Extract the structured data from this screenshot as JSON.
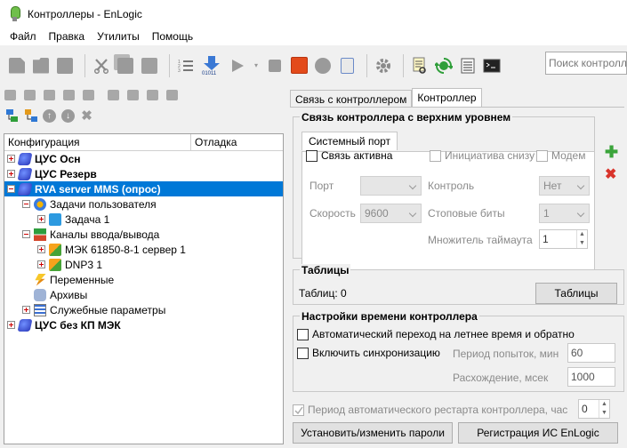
{
  "window": {
    "title": "Контроллеры - EnLogic"
  },
  "menu": [
    "Файл",
    "Правка",
    "Утилиты",
    "Помощь"
  ],
  "search": {
    "placeholder": "Поиск контроллера"
  },
  "tree": {
    "col_config": "Конфигурация",
    "col_debug": "Отладка",
    "nodes": [
      {
        "label": "ЦУС Осн",
        "level": 0,
        "icon": "database-icon",
        "expander": "plus",
        "bold": true,
        "selected": false
      },
      {
        "label": "ЦУС Резерв",
        "level": 0,
        "icon": "database-icon",
        "expander": "plus",
        "bold": true,
        "selected": false
      },
      {
        "label": "RVA server MMS (опрос)",
        "level": 0,
        "icon": "database-icon",
        "expander": "minus",
        "bold": true,
        "selected": true
      },
      {
        "label": "Задачи пользователя",
        "level": 1,
        "icon": "tasks-icon",
        "expander": "minus",
        "bold": false,
        "selected": false
      },
      {
        "label": "Задача 1",
        "level": 2,
        "icon": "cube-icon",
        "expander": "plus",
        "bold": false,
        "selected": false
      },
      {
        "label": "Каналы ввода/вывода",
        "level": 1,
        "icon": "channels-icon",
        "expander": "minus",
        "bold": false,
        "selected": false
      },
      {
        "label": "МЭК 61850-8-1 сервер 1",
        "level": 2,
        "icon": "plug-icon",
        "expander": "plus",
        "bold": false,
        "selected": false
      },
      {
        "label": "DNP3 1",
        "level": 2,
        "icon": "plug-icon",
        "expander": "plus",
        "bold": false,
        "selected": false
      },
      {
        "label": "Переменные",
        "level": 1,
        "icon": "variables-icon",
        "expander": "none",
        "bold": false,
        "selected": false
      },
      {
        "label": "Архивы",
        "level": 1,
        "icon": "archive-icon",
        "expander": "none",
        "bold": false,
        "selected": false
      },
      {
        "label": "Служебные параметры",
        "level": 1,
        "icon": "service-params-icon",
        "expander": "plus",
        "bold": false,
        "selected": false
      },
      {
        "label": "ЦУС без КП МЭК",
        "level": 0,
        "icon": "database-icon",
        "expander": "plus",
        "bold": true,
        "selected": false
      }
    ]
  },
  "tabs": [
    "Связь с контроллером",
    "Контроллер"
  ],
  "active_tab": 1,
  "upper_link": {
    "title": "Связь контроллера с верхним уровнем",
    "subtab": "Системный порт",
    "link_active": "Связь активна",
    "initiative": "Инициатива снизу",
    "modem": "Модем",
    "port_label": "Порт",
    "port_value": "",
    "control_label": "Контроль",
    "control_value": "Нет",
    "speed_label": "Скорость",
    "speed_value": "9600",
    "stop_bits_label": "Стоповые биты",
    "stop_bits_value": "1",
    "timeout_mult_label": "Множитель таймаута",
    "timeout_mult_value": "1"
  },
  "tables": {
    "title": "Таблицы",
    "count_text": "Таблиц: 0",
    "button": "Таблицы"
  },
  "time": {
    "title": "Настройки времени контроллера",
    "dst": "Автоматический переход на летнее время и обратно",
    "sync": "Включить синхронизацию",
    "attempt_period_label": "Период попыток, мин",
    "attempt_period_value": "60",
    "divergence_label": "Расхождение, мсек",
    "divergence_value": "1000"
  },
  "restart": {
    "label": "Период автоматического рестарта контроллера, час",
    "value": "0"
  },
  "buttons": {
    "passwords": "Установить/изменить пароли",
    "registration": "Регистрация ИС EnLogic"
  },
  "colors": {
    "selection": "#0078d7",
    "add": "#3aa43a",
    "delete": "#d9342b",
    "stop": "#e34b1b"
  }
}
